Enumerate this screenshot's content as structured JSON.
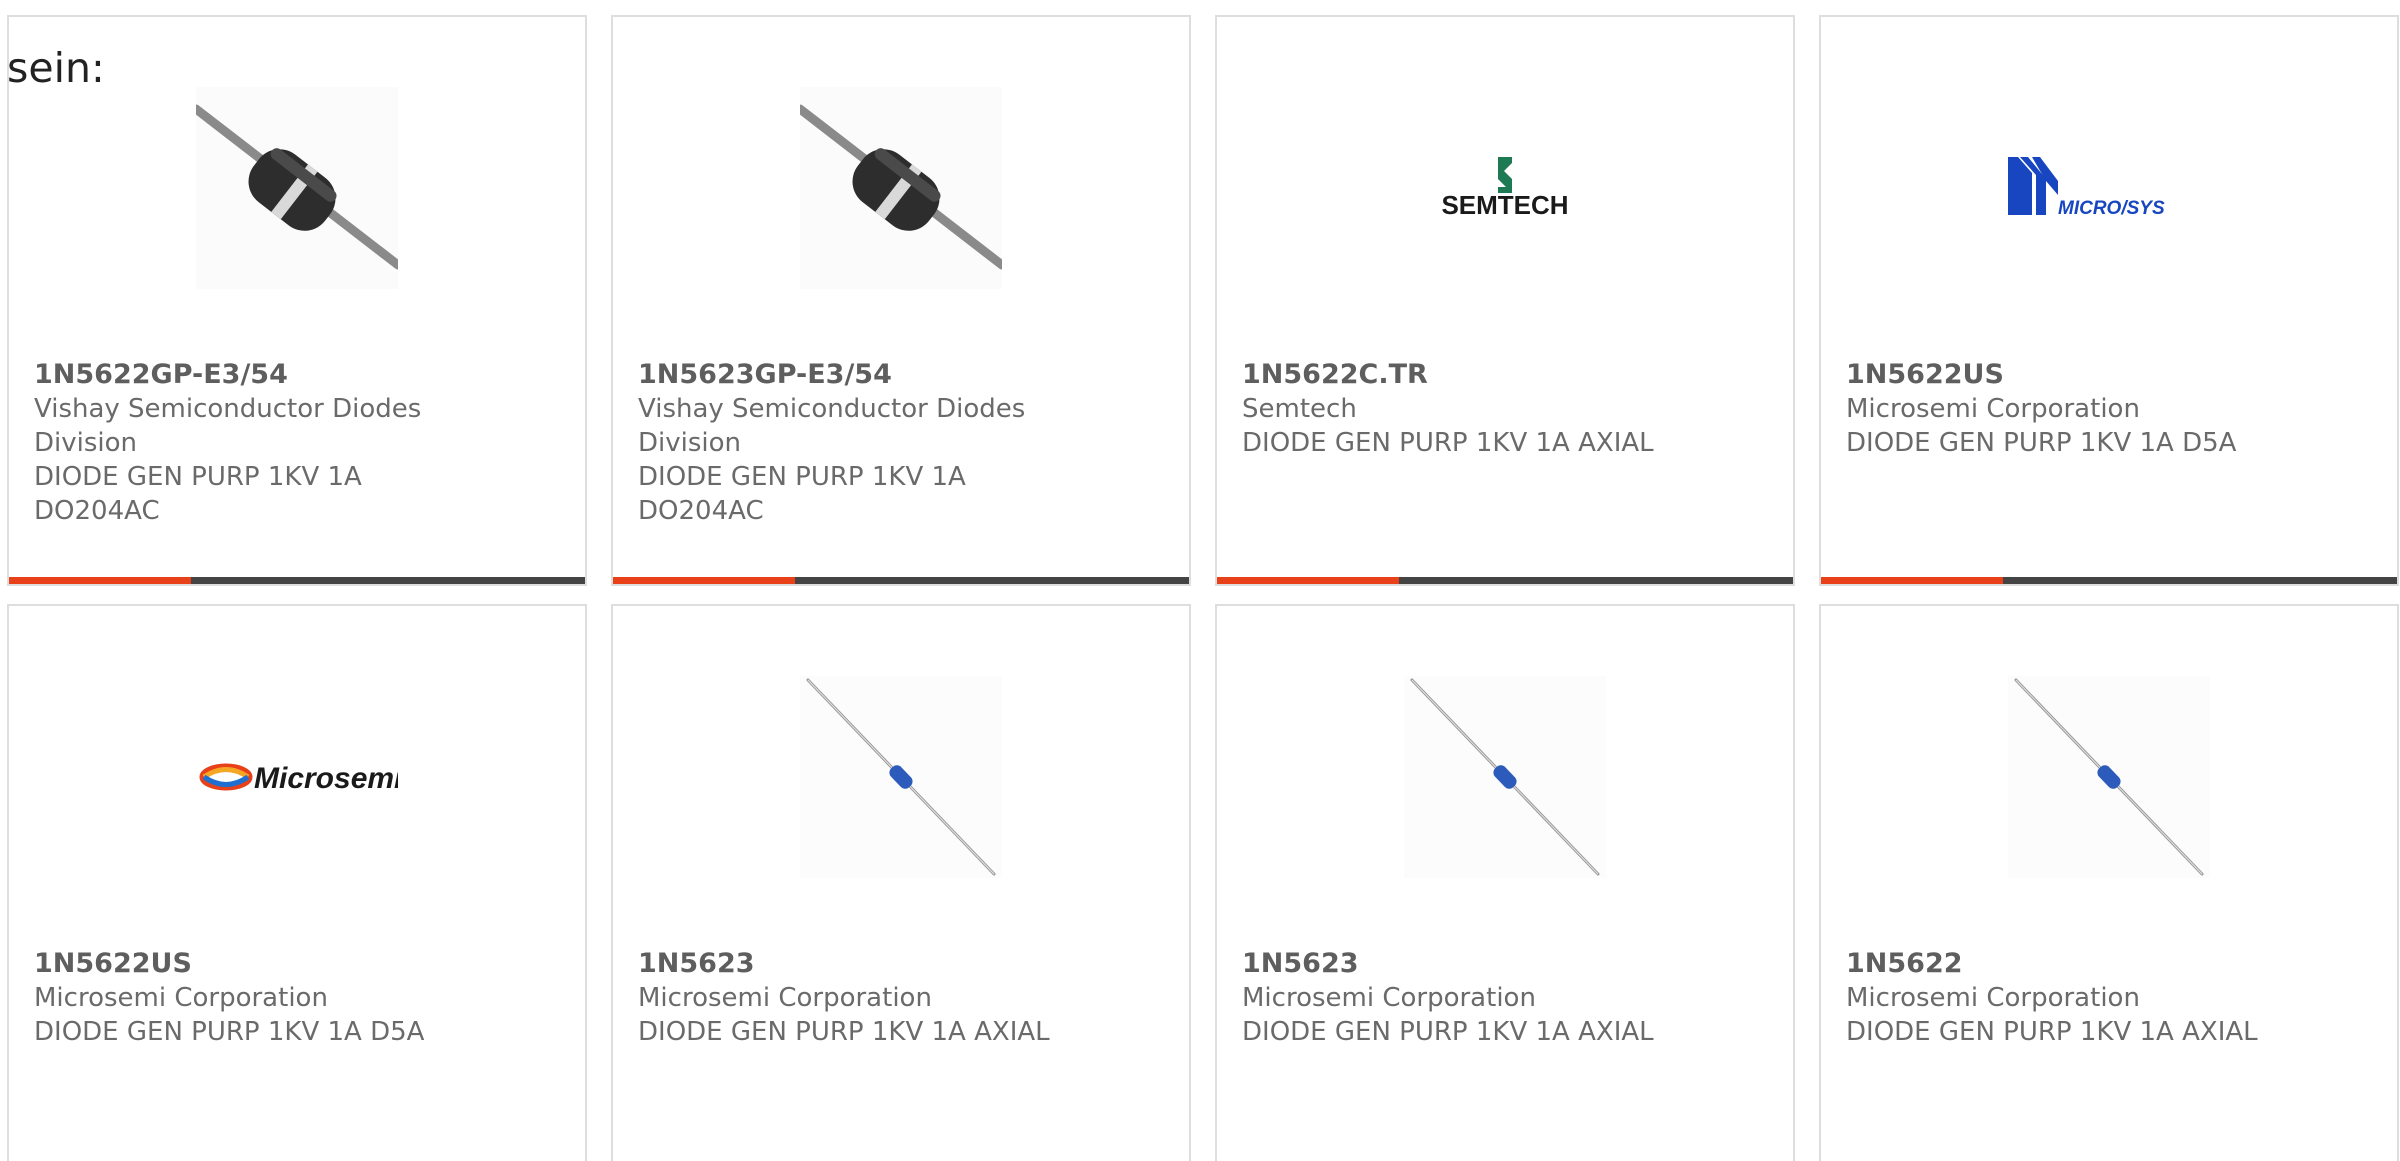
{
  "intro": {
    "text": "sein:"
  },
  "colors": {
    "accent": "#e8411a",
    "bar": "#444444",
    "border": "#dedede",
    "text": "#666666"
  },
  "products": [
    {
      "part_number": "1N5622GP-E3/54",
      "manufacturer": "Vishay Semiconductor Diodes Division",
      "description": "DIODE GEN PURP 1KV 1A DO204AC",
      "image": "diode-do204ac-photo",
      "has_accent_bar": true
    },
    {
      "part_number": "1N5623GP-E3/54",
      "manufacturer": "Vishay Semiconductor Diodes Division",
      "description": "DIODE GEN PURP 1KV 1A DO204AC",
      "image": "diode-do204ac-photo",
      "has_accent_bar": true
    },
    {
      "part_number": "1N5622C.TR",
      "manufacturer": "Semtech",
      "description": "DIODE GEN PURP 1KV 1A AXIAL",
      "image": "semtech-logo",
      "logo_text": "SEMTECH",
      "has_accent_bar": true
    },
    {
      "part_number": "1N5622US",
      "manufacturer": "Microsemi Corporation",
      "description": "DIODE GEN PURP 1KV 1A D5A",
      "image": "microsys-logo",
      "logo_text": "MICRO/SYS",
      "has_accent_bar": true
    },
    {
      "part_number": "1N5622US",
      "manufacturer": "Microsemi Corporation",
      "description": "DIODE GEN PURP 1KV 1A D5A",
      "image": "microsemi-logo",
      "logo_text": "Microsemi",
      "has_accent_bar": false
    },
    {
      "part_number": "1N5623",
      "manufacturer": "Microsemi Corporation",
      "description": "DIODE GEN PURP 1KV 1A AXIAL",
      "image": "diode-axial-glass-photo",
      "has_accent_bar": false
    },
    {
      "part_number": "1N5623",
      "manufacturer": "Microsemi Corporation",
      "description": "DIODE GEN PURP 1KV 1A AXIAL",
      "image": "diode-axial-glass-photo",
      "has_accent_bar": false
    },
    {
      "part_number": "1N5622",
      "manufacturer": "Microsemi Corporation",
      "description": "DIODE GEN PURP 1KV 1A AXIAL",
      "image": "diode-axial-glass-photo",
      "has_accent_bar": false
    }
  ]
}
